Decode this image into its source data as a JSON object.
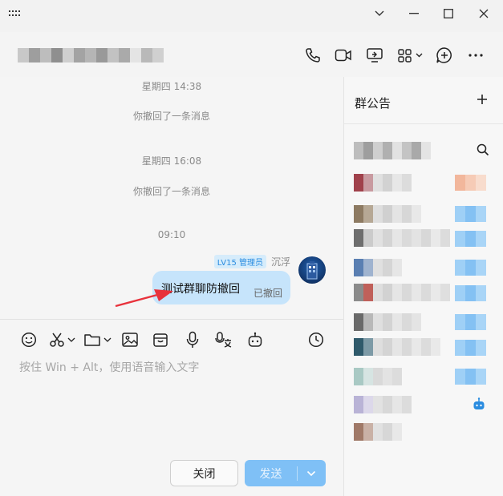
{
  "chat": {
    "time1": "星期四 14:38",
    "recall1": "你撤回了一条消息",
    "time2": "星期四 16:08",
    "recall2": "你撤回了一条消息",
    "time3": "09:10",
    "sender_badge": "LV15 管理员",
    "sender_name": "沉浮",
    "message_text": "测试群聊防撤回",
    "message_status": "已撤回"
  },
  "input": {
    "placeholder": "按住 Win + Alt，使用语音输入文字"
  },
  "buttons": {
    "close": "关闭",
    "send": "发送"
  },
  "side": {
    "title": "群公告"
  },
  "colors": {
    "accent": "#2a8ce0",
    "bubble": "#c6e4fb",
    "send_button": "#7fc0f6",
    "arrow": "#e8323c"
  },
  "icons": [
    "grid-menu-icon",
    "chevron-down-icon",
    "minimize-icon",
    "maximize-icon",
    "close-icon",
    "phone-icon",
    "video-icon",
    "screen-share-icon",
    "apps-icon",
    "add-chat-icon",
    "more-icon",
    "emoji-icon",
    "scissors-icon",
    "folder-icon",
    "image-icon",
    "box-icon",
    "microphone-icon",
    "voice-to-text-icon",
    "robot-icon",
    "clock-icon",
    "plus-icon",
    "search-icon"
  ]
}
